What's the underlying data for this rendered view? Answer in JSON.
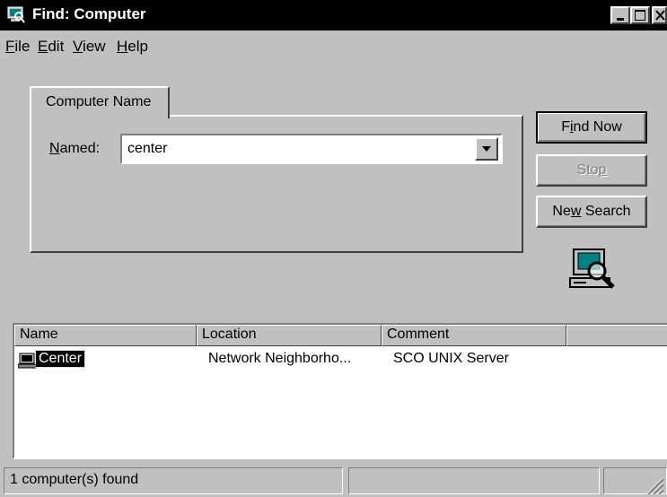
{
  "window": {
    "title": "Find: Computer"
  },
  "menu": [
    {
      "label": "File",
      "accel": "F",
      "rest": "ile"
    },
    {
      "label": "Edit",
      "accel": "E",
      "rest": "dit"
    },
    {
      "label": "View",
      "accel": "V",
      "rest": "iew"
    },
    {
      "label": "Help",
      "accel": "H",
      "rest": "elp"
    }
  ],
  "tab": {
    "label": "Computer Name"
  },
  "named": {
    "accel": "N",
    "rest": "amed:",
    "value": "center"
  },
  "buttons": {
    "find_now": {
      "pre": "F",
      "accel": "i",
      "post": "nd Now"
    },
    "stop": {
      "pre": "Sto",
      "accel": "p",
      "post": ""
    },
    "new_search": {
      "pre": "Ne",
      "accel": "w",
      "post": " Search"
    }
  },
  "columns": [
    "Name",
    "Location",
    "Comment",
    ""
  ],
  "results": [
    {
      "name": "Center",
      "location": "Network Neighborho...",
      "comment": "SCO UNIX Server"
    }
  ],
  "status": {
    "text": "1 computer(s) found"
  },
  "icons": {
    "title": "find-computer-icon",
    "result": "computer-icon",
    "search_graphic": "computer-search-icon"
  }
}
